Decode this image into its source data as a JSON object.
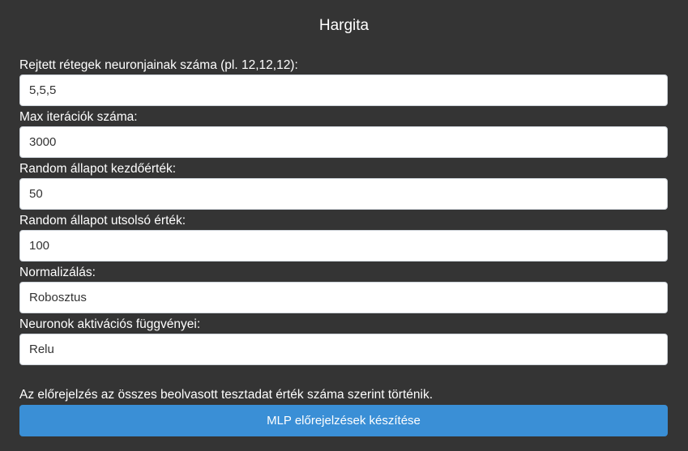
{
  "page": {
    "title": "Hargita"
  },
  "form": {
    "fields": [
      {
        "label": "Rejtett rétegek neuronjainak száma (pl. 12,12,12):",
        "value": "5,5,5"
      },
      {
        "label": "Max iterációk száma:",
        "value": "3000"
      },
      {
        "label": "Random állapot kezdőérték:",
        "value": "50"
      },
      {
        "label": "Random állapot utsolsó érték:",
        "value": "100"
      },
      {
        "label": "Normalizálás:",
        "value": "Robosztus"
      },
      {
        "label": "Neuronok aktivációs függvényei:",
        "value": "Relu"
      }
    ],
    "note": "Az előrejelzés az összes beolvasott tesztadat érték száma szerint történik.",
    "submit_label": "MLP előrejelzések készítése"
  },
  "colors": {
    "background": "#343434",
    "button": "#3a8fd6",
    "input_background": "#ffffff"
  }
}
